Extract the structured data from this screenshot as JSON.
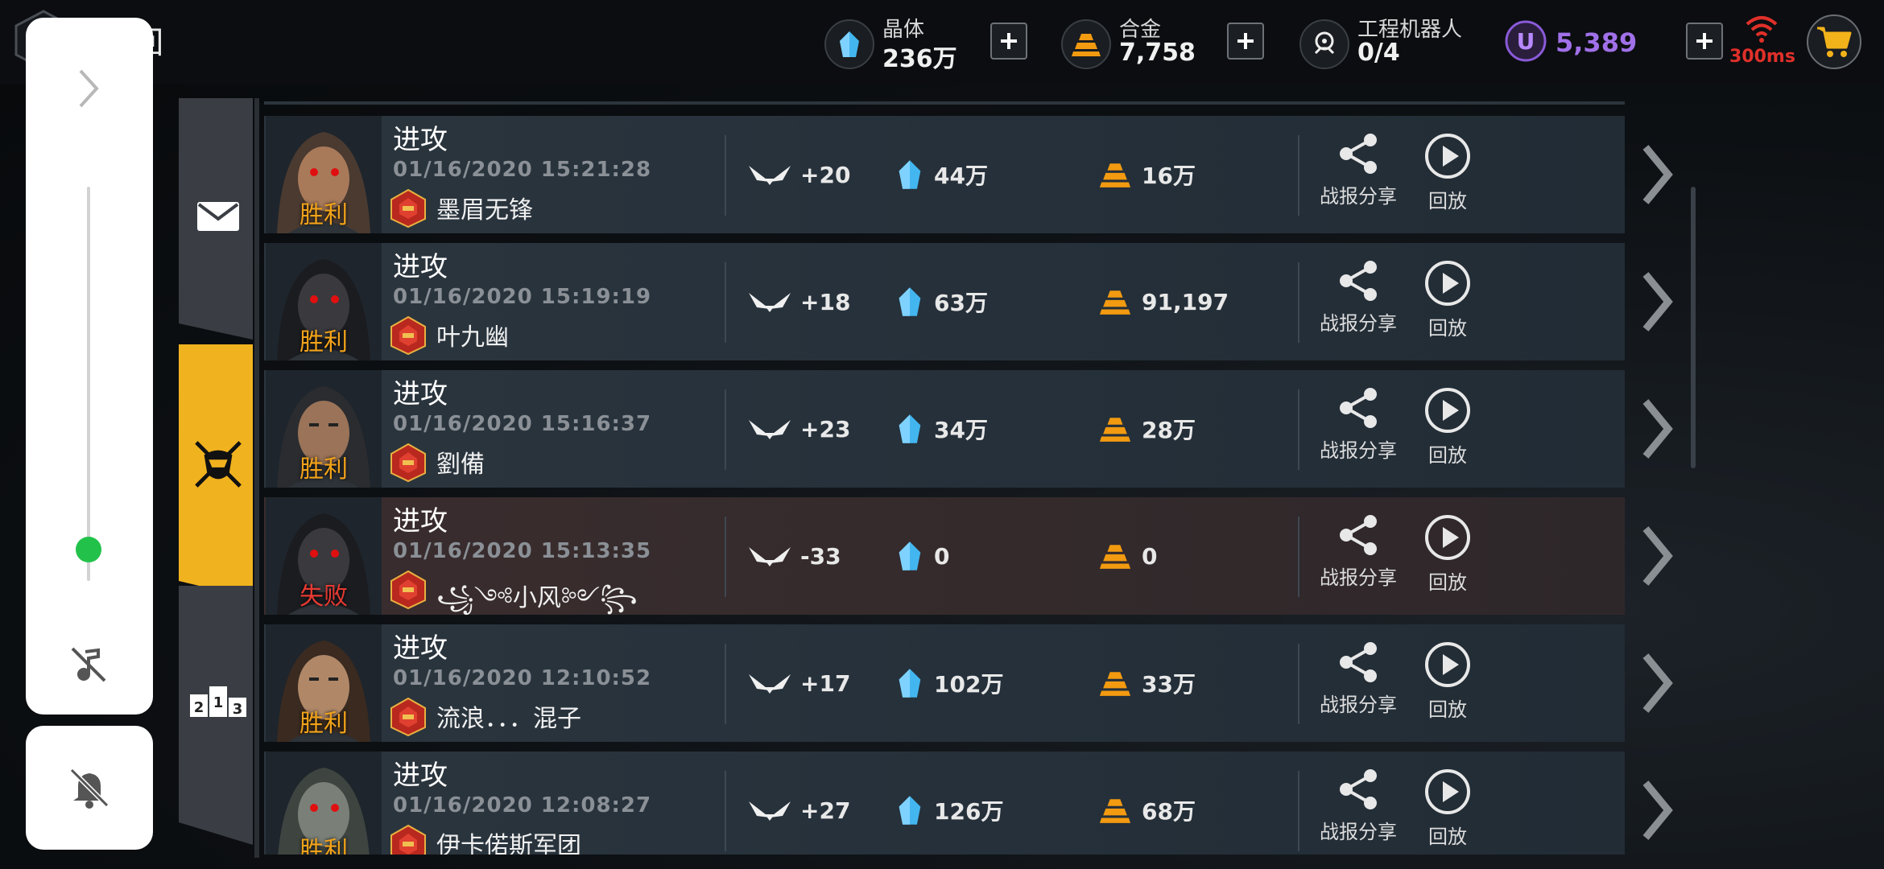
{
  "header": {
    "back_label": "回",
    "resources": [
      {
        "name": "晶体",
        "value": "236万",
        "icon": "crystal-icon"
      },
      {
        "name": "合金",
        "value": "7,758",
        "icon": "alloy-icon"
      },
      {
        "name": "工程机器人",
        "value": "0/4",
        "icon": "robot-icon"
      }
    ],
    "u_currency": {
      "badge": "U",
      "value": "5,389"
    },
    "ping": "300ms",
    "colors": {
      "accent_gold": "#f2a31a",
      "u_purple": "#a070e8",
      "ping_red": "#e0302a",
      "crystal_blue": "#43b6f0",
      "alloy_orange": "#f29a10"
    }
  },
  "overlay": {
    "top_icon": "chevron-right-icon",
    "slider_level": 0.08,
    "mute_icon": "music-off-icon",
    "bell_icon": "bell-off-icon"
  },
  "tabs": [
    {
      "icon": "mail-icon",
      "active": false
    },
    {
      "icon": "battle-emblem-icon",
      "active": true
    },
    {
      "icon": "ranking-podium-icon",
      "active": false
    }
  ],
  "ranking_digits": [
    "2",
    "1",
    "3"
  ],
  "actions": {
    "share_label": "战报分享",
    "replay_label": "回放"
  },
  "battles": [
    {
      "type": "进攻",
      "time": "01/16/2020 15:21:28",
      "opponent": "墨眉无锋",
      "result": "胜利",
      "trophy": "+20",
      "crystal": "44万",
      "alloy": "16万",
      "loss": false
    },
    {
      "type": "进攻",
      "time": "01/16/2020 15:19:19",
      "opponent": "叶九幽",
      "result": "胜利",
      "trophy": "+18",
      "crystal": "63万",
      "alloy": "91,197",
      "loss": false
    },
    {
      "type": "进攻",
      "time": "01/16/2020 15:16:37",
      "opponent": "劉備",
      "result": "胜利",
      "trophy": "+23",
      "crystal": "34万",
      "alloy": "28万",
      "loss": false
    },
    {
      "type": "进攻",
      "time": "01/16/2020 15:13:35",
      "opponent": "꧁༺小风༻꧂",
      "result": "失败",
      "trophy": "-33",
      "crystal": "0",
      "alloy": "0",
      "loss": true
    },
    {
      "type": "进攻",
      "time": "01/16/2020 12:10:52",
      "opponent": "流浪．．．混子",
      "result": "胜利",
      "trophy": "+17",
      "crystal": "102万",
      "alloy": "33万",
      "loss": false
    },
    {
      "type": "进攻",
      "time": "01/16/2020 12:08:27",
      "opponent": "伊卡偌斯军团",
      "result": "胜利",
      "trophy": "+27",
      "crystal": "126万",
      "alloy": "68万",
      "loss": false
    }
  ]
}
